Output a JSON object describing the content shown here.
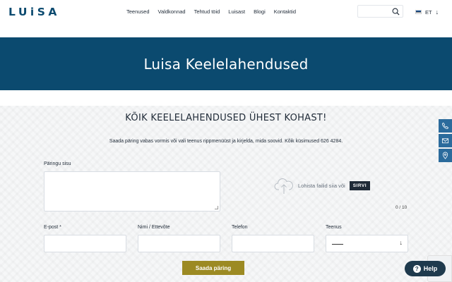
{
  "header": {
    "logo": "LUiSA",
    "nav": [
      "Teenused",
      "Valdkonnad",
      "Tehtud töid",
      "Luisast",
      "Blogi",
      "Kontaktid"
    ],
    "lang": "ET"
  },
  "hero": {
    "title": "Luisa Keelelahendused"
  },
  "section": {
    "heading": "KÕIK KEELELAHENDUSED ÜHEST KOHAST!",
    "intro": "Saada päring vabas vormis või vali teenus rippmenüüst ja kirjelda, mida soovid. Kõik küsimused 626 4284."
  },
  "form": {
    "message_label": "Päringu sisu",
    "upload_text": "Lohista failid siia või",
    "browse_label": "SIRVI",
    "file_counter": "0 / 10",
    "email_label": "E-post *",
    "name_label": "Nimi / Ettevõte",
    "phone_label": "Telefon",
    "service_label": "Teenus",
    "service_value": "",
    "submit_label": "Saada päring"
  },
  "help": {
    "label": "Help"
  },
  "colors": {
    "brand": "#0b4a6f",
    "accent": "#9c8a23",
    "side": "#2b6b9c"
  },
  "icons": [
    "search-icon",
    "chevron-down-icon",
    "cloud-upload-icon",
    "phone-icon",
    "mail-icon",
    "location-icon",
    "help-icon"
  ]
}
